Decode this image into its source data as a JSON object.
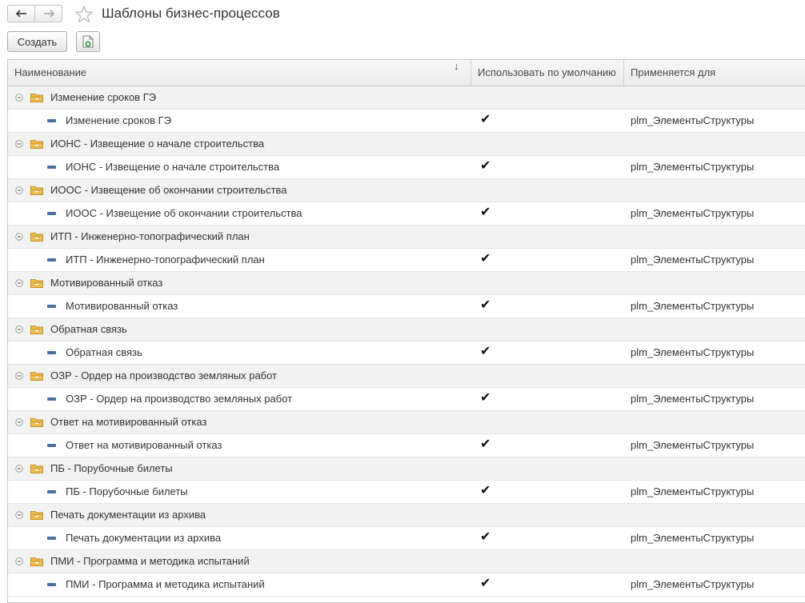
{
  "window": {
    "title": "Шаблоны бизнес-процессов"
  },
  "toolbar": {
    "create_label": "Создать"
  },
  "table": {
    "columns": {
      "name": "Наименование",
      "use_default": "Использовать по умолчанию",
      "applies_to": "Применяется для"
    },
    "sort_indicator": "↓",
    "groups": [
      {
        "label": "Изменение сроков ГЭ",
        "item": {
          "label": "Изменение сроков ГЭ",
          "check": "✔",
          "applies": "plm_ЭлементыСтруктуры"
        }
      },
      {
        "label": "ИОНС - Извещение о начале строительства",
        "item": {
          "label": "ИОНС - Извещение о начале строительства",
          "check": "✔",
          "applies": "plm_ЭлементыСтруктуры"
        }
      },
      {
        "label": "ИООС - Извещение об окончании строительства",
        "item": {
          "label": "ИООС - Извещение об окончании строительства",
          "check": "✔",
          "applies": "plm_ЭлементыСтруктуры"
        }
      },
      {
        "label": "ИТП - Инженерно-топографический план",
        "item": {
          "label": "ИТП - Инженерно-топографический план",
          "check": "✔",
          "applies": "plm_ЭлементыСтруктуры"
        }
      },
      {
        "label": "Мотивированный отказ",
        "item": {
          "label": "Мотивированный отказ",
          "check": "✔",
          "applies": "plm_ЭлементыСтруктуры"
        }
      },
      {
        "label": "Обратная связь",
        "item": {
          "label": "Обратная связь",
          "check": "✔",
          "applies": "plm_ЭлементыСтруктуры"
        }
      },
      {
        "label": "ОЗР - Ордер на производство земляных работ",
        "item": {
          "label": "ОЗР - Ордер на производство земляных работ",
          "check": "✔",
          "applies": "plm_ЭлементыСтруктуры"
        }
      },
      {
        "label": "Ответ на мотивированный отказ",
        "item": {
          "label": "Ответ на мотивированный отказ",
          "check": "✔",
          "applies": "plm_ЭлементыСтруктуры"
        }
      },
      {
        "label": "ПБ - Порубочные билеты",
        "item": {
          "label": "ПБ - Порубочные билеты",
          "check": "✔",
          "applies": "plm_ЭлементыСтруктуры"
        }
      },
      {
        "label": "Печать документации из архива",
        "item": {
          "label": "Печать документации из архива",
          "check": "✔",
          "applies": "plm_ЭлементыСтруктуры"
        }
      },
      {
        "label": "ПМИ - Программа и методика испытаний",
        "item": {
          "label": "ПМИ - Программа и методика испытаний",
          "check": "✔",
          "applies": "plm_ЭлементыСтруктуры"
        }
      }
    ]
  }
}
